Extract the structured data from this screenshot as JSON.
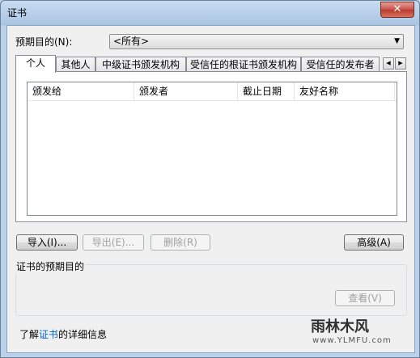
{
  "window": {
    "title": "证书",
    "close_symbol": "✕"
  },
  "purpose": {
    "label": "预期目的(N):",
    "selected": "<所有>"
  },
  "tabs": [
    {
      "label": "个人"
    },
    {
      "label": "其他人"
    },
    {
      "label": "中级证书颁发机构"
    },
    {
      "label": "受信任的根证书颁发机构"
    },
    {
      "label": "受信任的发布者"
    }
  ],
  "tab_scroll": {
    "left": "◀",
    "right": "▶"
  },
  "list": {
    "columns": [
      "颁发给",
      "颁发者",
      "截止日期",
      "友好名称"
    ]
  },
  "buttons": {
    "import": "导入(I)...",
    "export": "导出(E)...",
    "remove": "删除(R)",
    "advanced": "高级(A)",
    "view": "查看(V)"
  },
  "group": {
    "label": "证书的预期目的"
  },
  "footer": {
    "prefix": "了解",
    "link": "证书",
    "suffix": "的详细信息"
  },
  "watermark": {
    "text": "雨林木风",
    "url": "www.YLMFU.com"
  },
  "colors": {
    "accent_link": "#0066cc",
    "close_red": "#c75050"
  }
}
